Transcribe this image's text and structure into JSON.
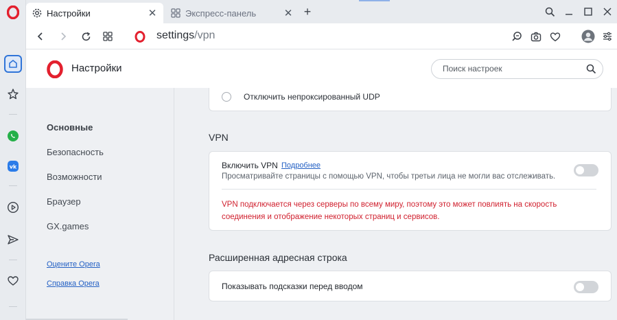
{
  "browser": {
    "tabs": [
      {
        "label": "Настройки",
        "active": true
      },
      {
        "label": "Экспресс-панель",
        "active": false
      }
    ],
    "url_host": "settings",
    "url_path": "/vpn"
  },
  "header": {
    "title": "Настройки",
    "search_placeholder": "Поиск настроек"
  },
  "nav": {
    "items": [
      {
        "label": "Основные",
        "active": true
      },
      {
        "label": "Безопасность",
        "active": false
      },
      {
        "label": "Возможности",
        "active": false
      },
      {
        "label": "Браузер",
        "active": false
      },
      {
        "label": "GX.games",
        "active": false
      }
    ],
    "links": [
      "Оцените Opera",
      "Справка Opera"
    ]
  },
  "content": {
    "udp_option": "Отключить непроксированный UDP",
    "vpn": {
      "section_title": "VPN",
      "enable_label": "Включить VPN",
      "more_link": "Подробнее",
      "description": "Просматривайте страницы с помощью VPN, чтобы третьи лица не могли вас отслеживать.",
      "warning": "VPN подключается через серверы по всему миру, поэтому это может повлиять на скорость соединения и отображение некоторых страниц и сервисов.",
      "enabled": false
    },
    "address_bar": {
      "section_title": "Расширенная адресная строка",
      "suggestions_label": "Показывать подсказки перед вводом",
      "enabled": false
    }
  },
  "colors": {
    "opera_red": "#e3202e",
    "link_blue": "#2360c4",
    "warning_red": "#d0202e",
    "sidebar_active": "#2f74d8"
  }
}
